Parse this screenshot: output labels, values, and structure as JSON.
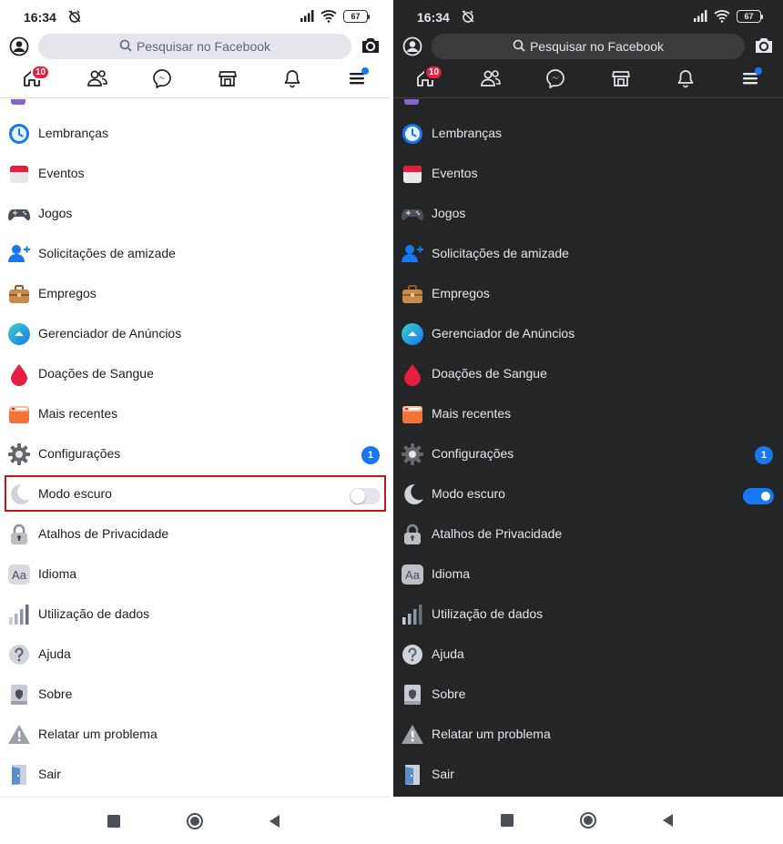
{
  "status_bar": {
    "time": "16:34",
    "battery": "67"
  },
  "search": {
    "placeholder": "Pesquisar no Facebook"
  },
  "tabs": {
    "home_badge": "10"
  },
  "menu": {
    "items": [
      {
        "label": "Lembranças",
        "icon": "memories-clock-icon"
      },
      {
        "label": "Eventos",
        "icon": "calendar-icon"
      },
      {
        "label": "Jogos",
        "icon": "gamepad-icon"
      },
      {
        "label": "Solicitações de amizade",
        "icon": "friend-request-icon"
      },
      {
        "label": "Empregos",
        "icon": "briefcase-icon"
      },
      {
        "label": "Gerenciador de Anúncios",
        "icon": "ads-manager-icon"
      },
      {
        "label": "Doações de Sangue",
        "icon": "blood-drop-icon"
      },
      {
        "label": "Mais recentes",
        "icon": "most-recent-icon"
      },
      {
        "label": "Configurações",
        "icon": "gear-icon",
        "badge": "1"
      },
      {
        "label": "Modo escuro",
        "icon": "moon-icon"
      },
      {
        "label": "Atalhos de Privacidade",
        "icon": "lock-icon"
      },
      {
        "label": "Idioma",
        "icon": "language-icon",
        "icon_text": "Aa"
      },
      {
        "label": "Utilização de dados",
        "icon": "data-usage-icon"
      },
      {
        "label": "Ajuda",
        "icon": "help-icon"
      },
      {
        "label": "Sobre",
        "icon": "about-icon"
      },
      {
        "label": "Relatar um problema",
        "icon": "warning-icon"
      },
      {
        "label": "Sair",
        "icon": "logout-door-icon"
      }
    ]
  },
  "dark_mode_toggle": {
    "light_screen": "off",
    "dark_screen": "on"
  },
  "colors": {
    "brand_blue": "#1877f2",
    "notification_red": "#e41e3f",
    "highlight_red": "#c0171e",
    "light_background": "#ffffff",
    "dark_background": "#242526"
  }
}
